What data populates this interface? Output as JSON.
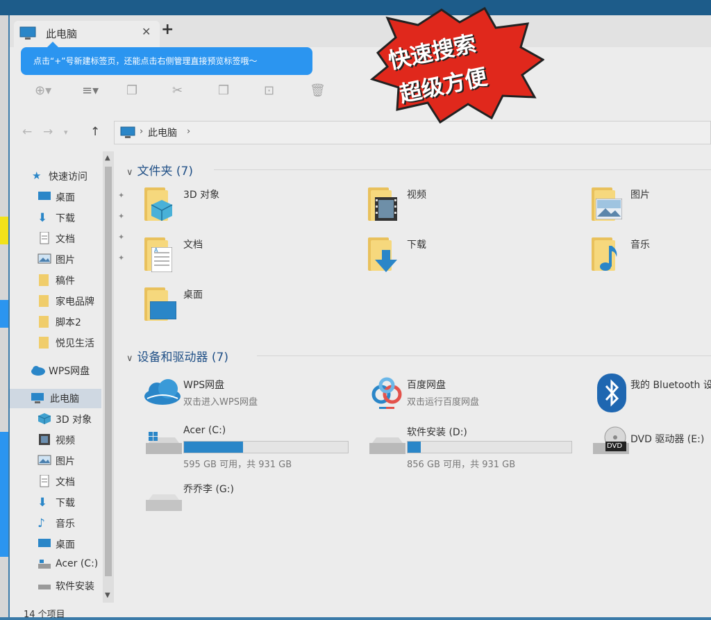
{
  "window": {
    "tab_title": "此电脑",
    "close_glyph": "✕",
    "new_tab_glyph": "+",
    "tooltip": "点击“+”号新建标签页，还能点击右侧管理直接预览标签哦～"
  },
  "toolbar": {
    "icons": [
      "new-icon",
      "view-icon",
      "copy-icon",
      "cut-icon",
      "paste-icon",
      "rename-icon",
      "delete-icon"
    ]
  },
  "address": {
    "back_glyph": "←",
    "forward_glyph": "→",
    "up_glyph": "↑",
    "crumbs": [
      "此电脑"
    ],
    "separator": "›"
  },
  "nav": {
    "quick_access": "快速访问",
    "items": [
      {
        "label": "桌面",
        "icon": "desktop-icon",
        "pinned": true
      },
      {
        "label": "下载",
        "icon": "download-icon",
        "pinned": true
      },
      {
        "label": "文档",
        "icon": "document-icon",
        "pinned": true
      },
      {
        "label": "图片",
        "icon": "picture-icon",
        "pinned": true
      },
      {
        "label": "稿件",
        "icon": "folder-icon",
        "pinned": false
      },
      {
        "label": "家电品牌",
        "icon": "folder-icon",
        "pinned": false
      },
      {
        "label": "脚本2",
        "icon": "folder-icon",
        "pinned": false
      },
      {
        "label": "悦见生活",
        "icon": "folder-icon",
        "pinned": false
      }
    ],
    "wps": "WPS网盘",
    "this_pc": "此电脑",
    "pc_items": [
      {
        "label": "3D 对象",
        "icon": "3d-objects-icon"
      },
      {
        "label": "视频",
        "icon": "video-icon"
      },
      {
        "label": "图片",
        "icon": "picture-icon"
      },
      {
        "label": "文档",
        "icon": "document-icon"
      },
      {
        "label": "下载",
        "icon": "download-icon"
      },
      {
        "label": "音乐",
        "icon": "music-icon"
      },
      {
        "label": "桌面",
        "icon": "desktop-icon"
      },
      {
        "label": "Acer (C:)",
        "icon": "drive-icon"
      },
      {
        "label": "软件安装",
        "icon": "drive-icon"
      }
    ],
    "pin_glyph": "📌"
  },
  "status": "14 个项目",
  "content": {
    "folders_header": "文件夹 (7)",
    "folders": [
      {
        "label": "3D 对象",
        "icon": "3d-objects-icon"
      },
      {
        "label": "视频",
        "icon": "video-icon"
      },
      {
        "label": "图片",
        "icon": "picture-icon"
      },
      {
        "label": "文档",
        "icon": "document-icon"
      },
      {
        "label": "下载",
        "icon": "download-icon"
      },
      {
        "label": "音乐",
        "icon": "music-icon"
      },
      {
        "label": "桌面",
        "icon": "desktop-icon"
      }
    ],
    "devices_header": "设备和驱动器 (7)",
    "wps": {
      "label": "WPS网盘",
      "sub": "双击进入WPS网盘"
    },
    "baidu": {
      "label": "百度网盘",
      "sub": "双击运行百度网盘"
    },
    "bluetooth": {
      "label": "我的 Bluetooth 设"
    },
    "drives": [
      {
        "label": "Acer (C:)",
        "free": "595 GB 可用，共 931 GB",
        "used_fraction": 0.36
      },
      {
        "label": "软件安装 (D:)",
        "free": "856 GB 可用，共 931 GB",
        "used_fraction": 0.08
      }
    ],
    "dvd": {
      "label": "DVD 驱动器 (E:)",
      "badge": "DVD"
    },
    "g_drive": {
      "label": "乔乔李 (G:)"
    }
  },
  "stamp": {
    "line1": "快速搜索",
    "line2": "超级方便"
  },
  "colors": {
    "accent": "#2b95f0",
    "drive_fill": "#2a86c8",
    "folder": "#f6d87d",
    "stamp_red": "#e0281c"
  }
}
